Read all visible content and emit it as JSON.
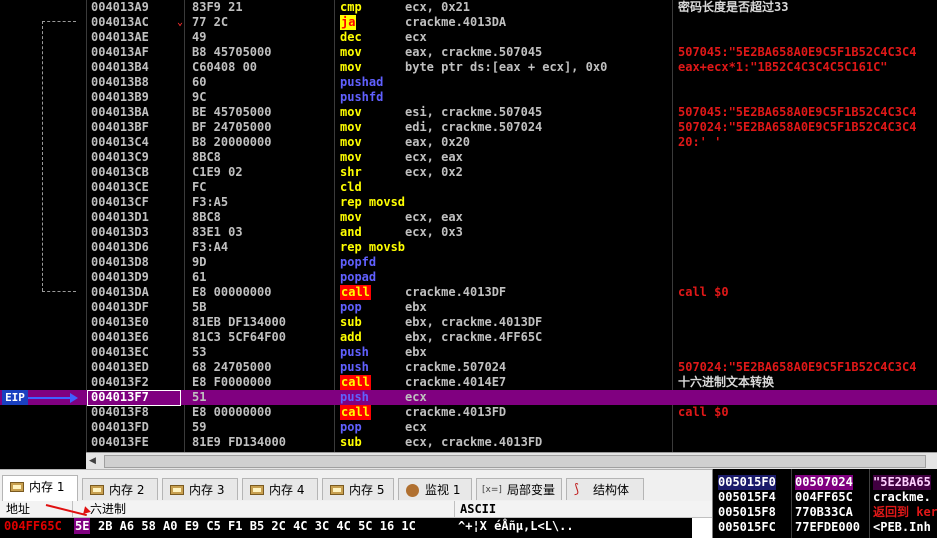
{
  "disasm": [
    {
      "addr": "004013A9",
      "hex": "83F9 21",
      "mn": "cmp",
      "op": "ecx, 0x21",
      "cm": "密码长度是否超过33",
      "cmw": true
    },
    {
      "addr": "004013AC",
      "hex": "77 2C",
      "mn": "ja",
      "op": "crackme.4013DA",
      "kind": "ja",
      "mark": "⌄"
    },
    {
      "addr": "004013AE",
      "hex": "49",
      "mn": "dec",
      "op": "ecx"
    },
    {
      "addr": "004013AF",
      "hex": "B8 45705000",
      "mn": "mov",
      "op": "eax, crackme.507045",
      "cm": "507045:\"5E2BA658A0E9C5F1B52C4C3C4"
    },
    {
      "addr": "004013B4",
      "hex": "C60408 00",
      "mn": "mov",
      "op": "byte ptr ds:[eax + ecx], 0x0",
      "cm": "eax+ecx*1:\"1B52C4C3C4C5C161C\""
    },
    {
      "addr": "004013B8",
      "hex": "60",
      "mn": "pushad",
      "op": "",
      "kind": "push"
    },
    {
      "addr": "004013B9",
      "hex": "9C",
      "mn": "pushfd",
      "op": "",
      "kind": "push"
    },
    {
      "addr": "004013BA",
      "hex": "BE 45705000",
      "mn": "mov",
      "op": "esi, crackme.507045",
      "cm": "507045:\"5E2BA658A0E9C5F1B52C4C3C4"
    },
    {
      "addr": "004013BF",
      "hex": "BF 24705000",
      "mn": "mov",
      "op": "edi, crackme.507024",
      "cm": "507024:\"5E2BA658A0E9C5F1B52C4C3C4"
    },
    {
      "addr": "004013C4",
      "hex": "B8 20000000",
      "mn": "mov",
      "op": "eax, 0x20",
      "cm": "20:' '"
    },
    {
      "addr": "004013C9",
      "hex": "8BC8",
      "mn": "mov",
      "op": "ecx, eax"
    },
    {
      "addr": "004013CB",
      "hex": "C1E9 02",
      "mn": "shr",
      "op": "ecx, 0x2"
    },
    {
      "addr": "004013CE",
      "hex": "FC",
      "mn": "cld",
      "op": ""
    },
    {
      "addr": "004013CF",
      "hex": "F3:A5",
      "mn": "rep movsd",
      "op": ""
    },
    {
      "addr": "004013D1",
      "hex": "8BC8",
      "mn": "mov",
      "op": "ecx, eax"
    },
    {
      "addr": "004013D3",
      "hex": "83E1 03",
      "mn": "and",
      "op": "ecx, 0x3"
    },
    {
      "addr": "004013D6",
      "hex": "F3:A4",
      "mn": "rep movsb",
      "op": ""
    },
    {
      "addr": "004013D8",
      "hex": "9D",
      "mn": "popfd",
      "op": "",
      "kind": "push"
    },
    {
      "addr": "004013D9",
      "hex": "61",
      "mn": "popad",
      "op": "",
      "kind": "push"
    },
    {
      "addr": "004013DA",
      "hex": "E8 00000000",
      "mn": "call",
      "op": "crackme.4013DF",
      "kind": "call",
      "cm": "call $0"
    },
    {
      "addr": "004013DF",
      "hex": "5B",
      "mn": "pop",
      "op": "ebx",
      "kind": "push"
    },
    {
      "addr": "004013E0",
      "hex": "81EB DF134000",
      "mn": "sub",
      "op": "ebx, crackme.4013DF"
    },
    {
      "addr": "004013E6",
      "hex": "81C3 5CF64F00",
      "mn": "add",
      "op": "ebx, crackme.4FF65C"
    },
    {
      "addr": "004013EC",
      "hex": "53",
      "mn": "push",
      "op": "ebx",
      "kind": "push"
    },
    {
      "addr": "004013ED",
      "hex": "68 24705000",
      "mn": "push",
      "op": "crackme.507024",
      "kind": "push",
      "cm": "507024:\"5E2BA658A0E9C5F1B52C4C3C4"
    },
    {
      "addr": "004013F2",
      "hex": "E8 F0000000",
      "mn": "call",
      "op": "crackme.4014E7",
      "kind": "call",
      "cm": "十六进制文本转换",
      "cmw": true
    },
    {
      "addr": "004013F7",
      "hex": "51",
      "mn": "push",
      "op": "ecx",
      "kind": "push",
      "eip": true
    },
    {
      "addr": "004013F8",
      "hex": "E8 00000000",
      "mn": "call",
      "op": "crackme.4013FD",
      "kind": "call",
      "cm": "call $0"
    },
    {
      "addr": "004013FD",
      "hex": "59",
      "mn": "pop",
      "op": "ecx",
      "kind": "push"
    },
    {
      "addr": "004013FE",
      "hex": "81E9 FD134000",
      "mn": "sub",
      "op": "ecx, crackme.4013FD"
    }
  ],
  "eip_label": "EIP",
  "tabs": [
    {
      "label": "内存 1",
      "icon": "memory-icon",
      "active": true
    },
    {
      "label": "内存 2",
      "icon": "memory-icon"
    },
    {
      "label": "内存 3",
      "icon": "memory-icon"
    },
    {
      "label": "内存 4",
      "icon": "memory-icon"
    },
    {
      "label": "内存 5",
      "icon": "memory-icon"
    },
    {
      "label": "监视 1",
      "icon": "watch-icon"
    },
    {
      "label": "局部变量",
      "icon": "locals-icon",
      "prefix": "[x=]"
    },
    {
      "label": "结构体",
      "icon": "struct-icon"
    }
  ],
  "dump": {
    "headers": {
      "addr": "地址",
      "hex": "六进制",
      "ascii": "ASCII"
    },
    "row": {
      "addr": "004FF65C",
      "sel": "5E",
      "hex": "2B A6 58 A0 E9 C5 F1 B5 2C 4C 3C 4C 5C 16 1C",
      "ascii": "^+¦X éÅñµ,L<L\\.."
    }
  },
  "stack": [
    {
      "addr": "005015F0",
      "val": "00507024",
      "cm": "\"5E2BA65",
      "sel": true
    },
    {
      "addr": "005015F4",
      "val": "004FF65C",
      "cm": "crackme."
    },
    {
      "addr": "005015F8",
      "val": "770B33CA",
      "cm": "返回到 ker",
      "red": true
    },
    {
      "addr": "005015FC",
      "val": "77EFDE000",
      "cm": "<PEB.Inh"
    }
  ]
}
